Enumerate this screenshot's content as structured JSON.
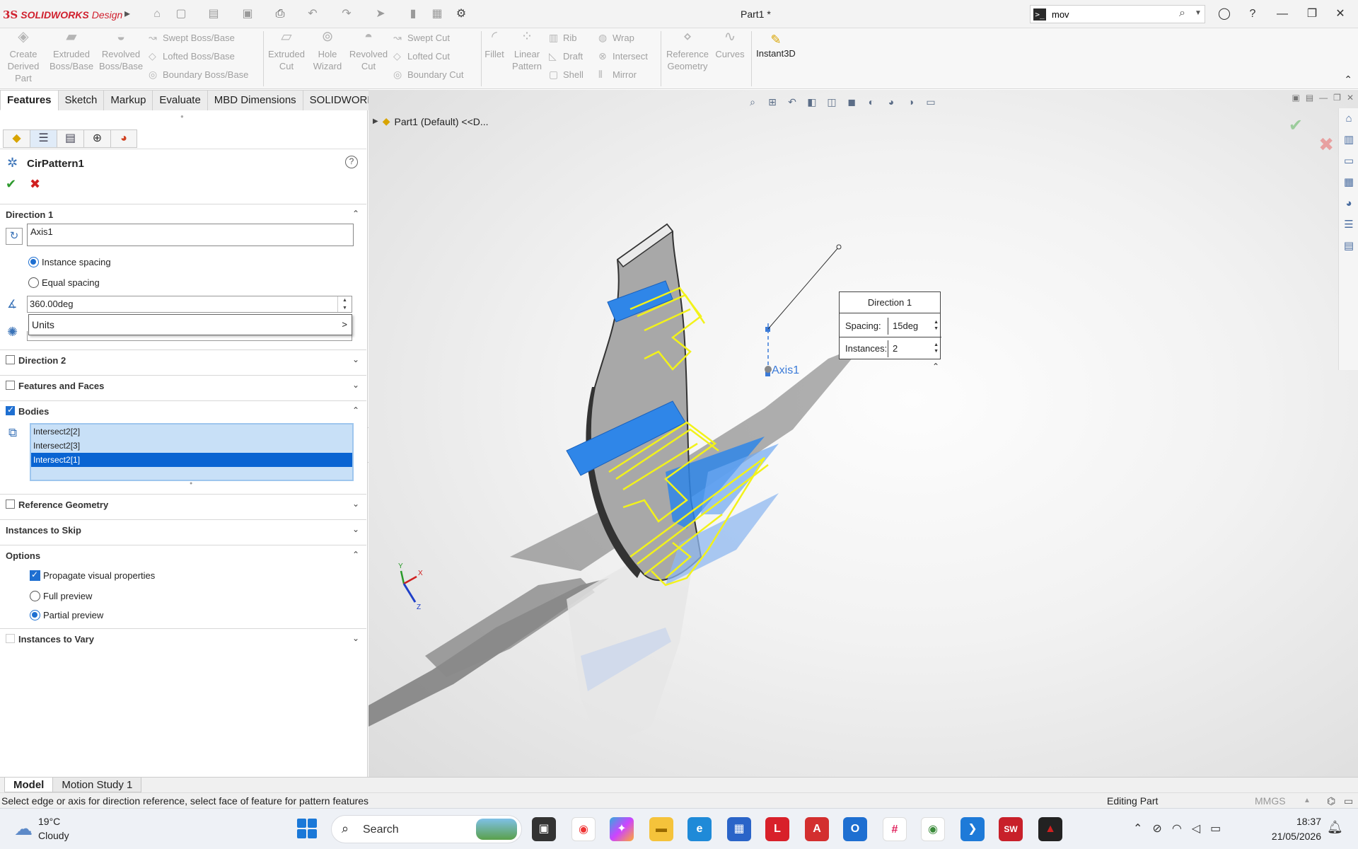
{
  "app": {
    "logo_brand": "SOLIDWORKS",
    "logo_product": "Design",
    "document_title": "Part1 *"
  },
  "titlebar_search": {
    "value": "mov"
  },
  "ribbon": {
    "big_buttons": [
      {
        "line1": "Create",
        "line2": "Derived",
        "line3": "Part"
      },
      {
        "line1": "Extruded",
        "line2": "Boss/Base"
      },
      {
        "line1": "Revolved",
        "line2": "Boss/Base"
      },
      {
        "line1": "Extruded",
        "line2": "Cut"
      },
      {
        "line1": "Hole",
        "line2": "Wizard"
      },
      {
        "line1": "Revolved",
        "line2": "Cut"
      },
      {
        "line1": "Fillet"
      },
      {
        "line1": "Linear",
        "line2": "Pattern"
      },
      {
        "line1": "Reference",
        "line2": "Geometry"
      },
      {
        "line1": "Curves"
      }
    ],
    "small_buttons": [
      "Swept Boss/Base",
      "Lofted Boss/Base",
      "Boundary Boss/Base",
      "Swept Cut",
      "Lofted Cut",
      "Boundary Cut",
      "Rib",
      "Draft",
      "Shell",
      "Wrap",
      "Intersect",
      "Mirror"
    ],
    "instant3d": "Instant3D"
  },
  "tabs": [
    "Features",
    "Sketch",
    "Markup",
    "Evaluate",
    "MBD Dimensions",
    "SOLIDWORKS Add-Ins"
  ],
  "property_manager": {
    "title": "CirPattern1",
    "help": "?",
    "direction1": {
      "header": "Direction 1",
      "axis_value": "Axis1",
      "radio_instance": "Instance spacing",
      "radio_equal": "Equal spacing",
      "angle_value": "360.00deg",
      "context_menu_item": "Units",
      "context_menu_arrow": ">"
    },
    "sections": {
      "direction2": "Direction 2",
      "features_faces": "Features and Faces",
      "bodies": "Bodies",
      "reference_geometry": "Reference Geometry",
      "instances_skip": "Instances to Skip",
      "options": "Options",
      "instances_vary": "Instances to Vary"
    },
    "bodies_list": [
      "Intersect2[2]",
      "Intersect2[3]",
      "Intersect2[1]"
    ],
    "options": {
      "propagate": "Propagate visual properties",
      "full_preview": "Full preview",
      "partial_preview": "Partial preview"
    }
  },
  "viewport": {
    "tree_label": "Part1 (Default) <<D...",
    "axis_label": "Axis1",
    "callout": {
      "header": "Direction 1",
      "spacing_label": "Spacing:",
      "spacing_value": "15deg",
      "instances_label": "Instances:",
      "instances_value": "2"
    },
    "triad": {
      "x": "X",
      "y": "Y",
      "z": "Z"
    },
    "colors": {
      "accent_blue": "#2f86e8",
      "preview_yellow": "#f2f21a",
      "body_gray": "#a8a8a8"
    }
  },
  "bottom_tabs": [
    "Model",
    "Motion Study 1"
  ],
  "status": {
    "message": "Select edge or axis for direction reference, select face of feature for pattern features",
    "mode": "Editing Part",
    "units": "MMGS"
  },
  "taskbar": {
    "temp": "19°C",
    "condition": "Cloudy",
    "search": "Search",
    "time": "18:37",
    "date": "21/05/2026"
  }
}
